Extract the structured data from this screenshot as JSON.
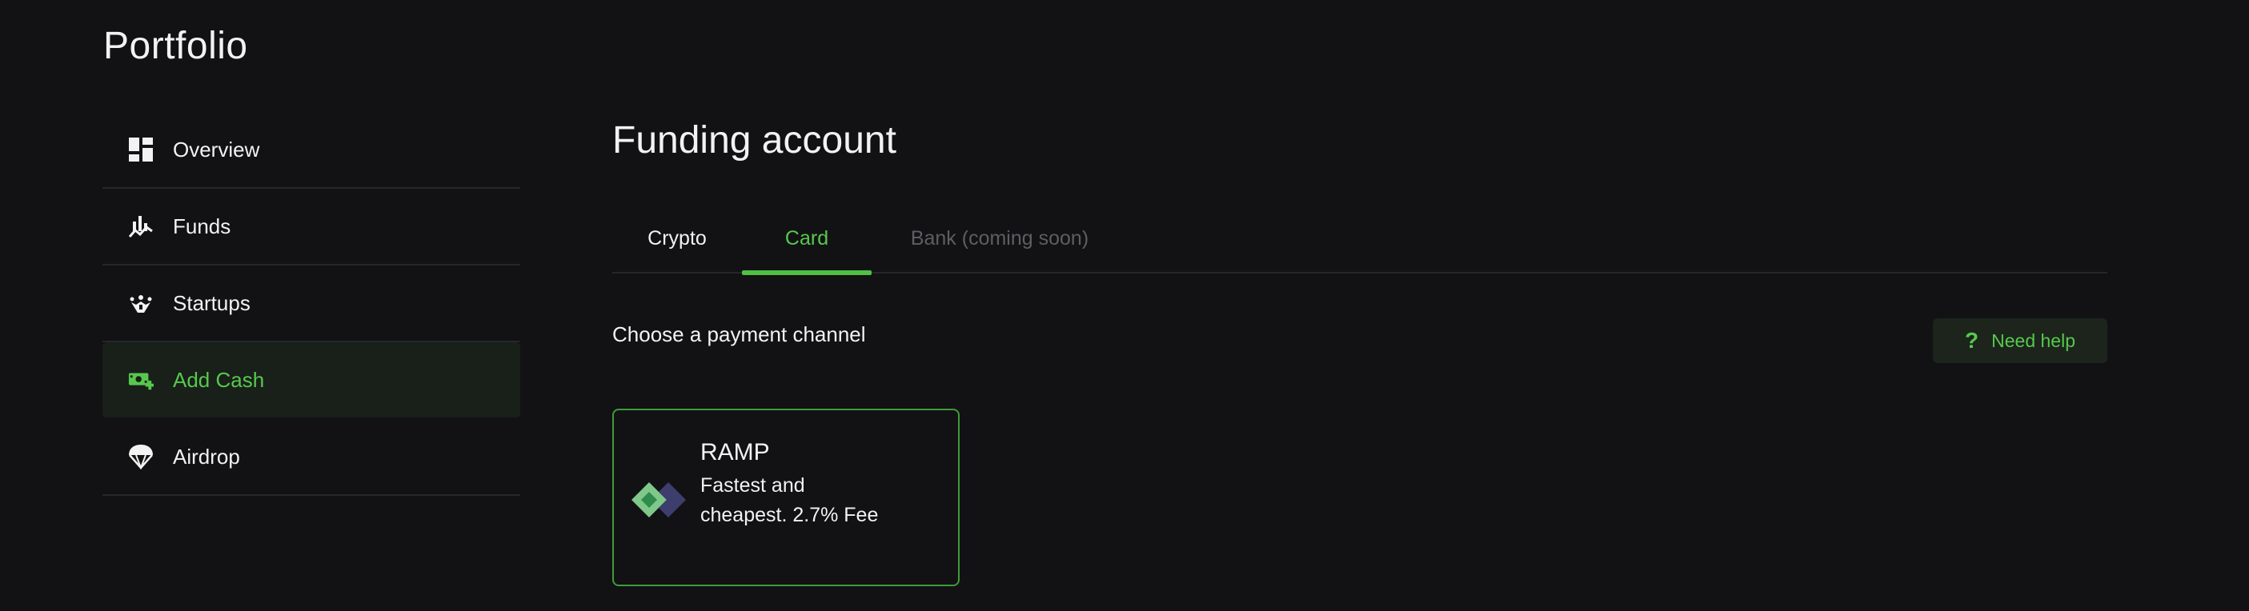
{
  "page": {
    "title": "Portfolio"
  },
  "sidebar": {
    "items": [
      {
        "label": "Overview",
        "icon": "dashboard-icon",
        "active": false
      },
      {
        "label": "Funds",
        "icon": "chart-icon",
        "active": false
      },
      {
        "label": "Startups",
        "icon": "startups-icon",
        "active": false
      },
      {
        "label": "Add Cash",
        "icon": "add-cash-icon",
        "active": true
      },
      {
        "label": "Airdrop",
        "icon": "parachute-icon",
        "active": false
      }
    ]
  },
  "main": {
    "title": "Funding account",
    "tabs": [
      {
        "label": "Crypto",
        "active": false
      },
      {
        "label": "Card",
        "active": true
      },
      {
        "label": "Bank (coming soon)",
        "disabled": true
      }
    ],
    "choose_label": "Choose a payment channel",
    "help_button": {
      "icon": "question-icon",
      "label": "Need help"
    },
    "payment_options": [
      {
        "name": "RAMP",
        "description": "Fastest and cheapest. 2.7% Fee",
        "icon": "ramp-logo-icon",
        "selected": true
      }
    ]
  },
  "colors": {
    "background": "#121214",
    "accent": "#57c84d",
    "active_bg": "#182019",
    "divider": "#26262a",
    "disabled_text": "#5e5e62"
  }
}
